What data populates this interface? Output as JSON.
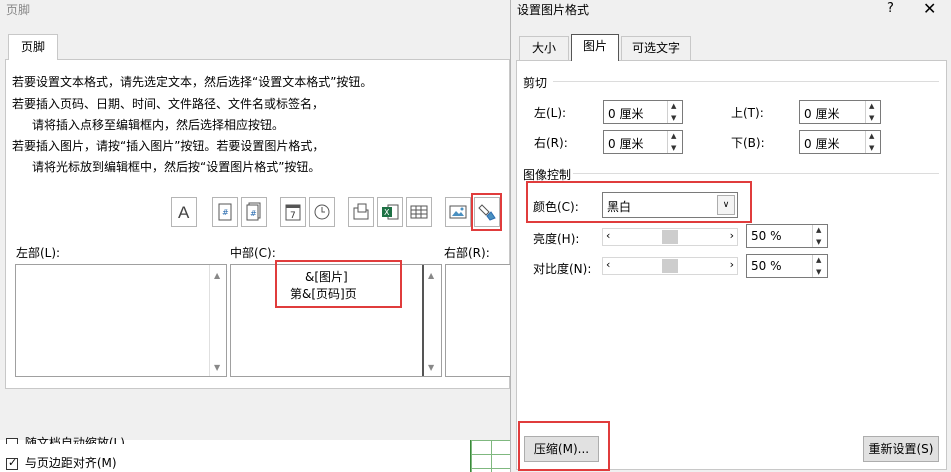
{
  "bg_dialog": {
    "title": "页脚",
    "tab": "页脚",
    "instructions": [
      "若要设置文本格式，请先选定文本，然后选择“设置文本格式”按钮。",
      "若要插入页码、日期、时间、文件路径、文件名或标签名，",
      "请将插入点移至编辑框内，然后选择相应按钮。",
      "若要插入图片，请按“插入图片”按钮。若要设置图片格式，",
      "请将光标放到编辑框中，然后按“设置图片格式”按钮。"
    ],
    "toolbar_icons": [
      "format-text-icon",
      "insert-page-number-icon",
      "insert-page-count-icon",
      "insert-date-icon",
      "insert-time-icon",
      "insert-file-path-icon",
      "insert-file-name-icon",
      "insert-sheet-name-icon",
      "insert-picture-icon",
      "format-picture-icon"
    ],
    "left_label": "左部(L):",
    "center_label": "中部(C):",
    "right_label": "右部(R):",
    "center_line1": "&[图片]",
    "center_line2": "第&[页码]页",
    "bottom_checkbox1": "随文档自动缩放(L)",
    "bottom_checkbox2": "与页边距对齐(M)"
  },
  "picture_dialog": {
    "title": "设置图片格式",
    "help": "?",
    "close": "✕",
    "tabs": [
      "大小",
      "图片",
      "可选文字"
    ],
    "active_tab": "图片",
    "crop": {
      "group": "剪切",
      "left_label": "左(L):",
      "left_value": "0 厘米",
      "top_label": "上(T):",
      "top_value": "0 厘米",
      "right_label": "右(R):",
      "right_value": "0 厘米",
      "bottom_label": "下(B):",
      "bottom_value": "0 厘米"
    },
    "image_control": {
      "group": "图像控制",
      "color_label": "颜色(C):",
      "color_value": "黑白",
      "brightness_label": "亮度(H):",
      "brightness_value": "50 %",
      "brightness_level": 0.5,
      "contrast_label": "对比度(N):",
      "contrast_value": "50 %",
      "contrast_level": 0.5
    },
    "compress_button": "压缩(M)...",
    "reset_button": "重新设置(S)"
  },
  "colors": {
    "highlight": "#e03c3c",
    "dialog_bg": "#f0f0f0"
  }
}
